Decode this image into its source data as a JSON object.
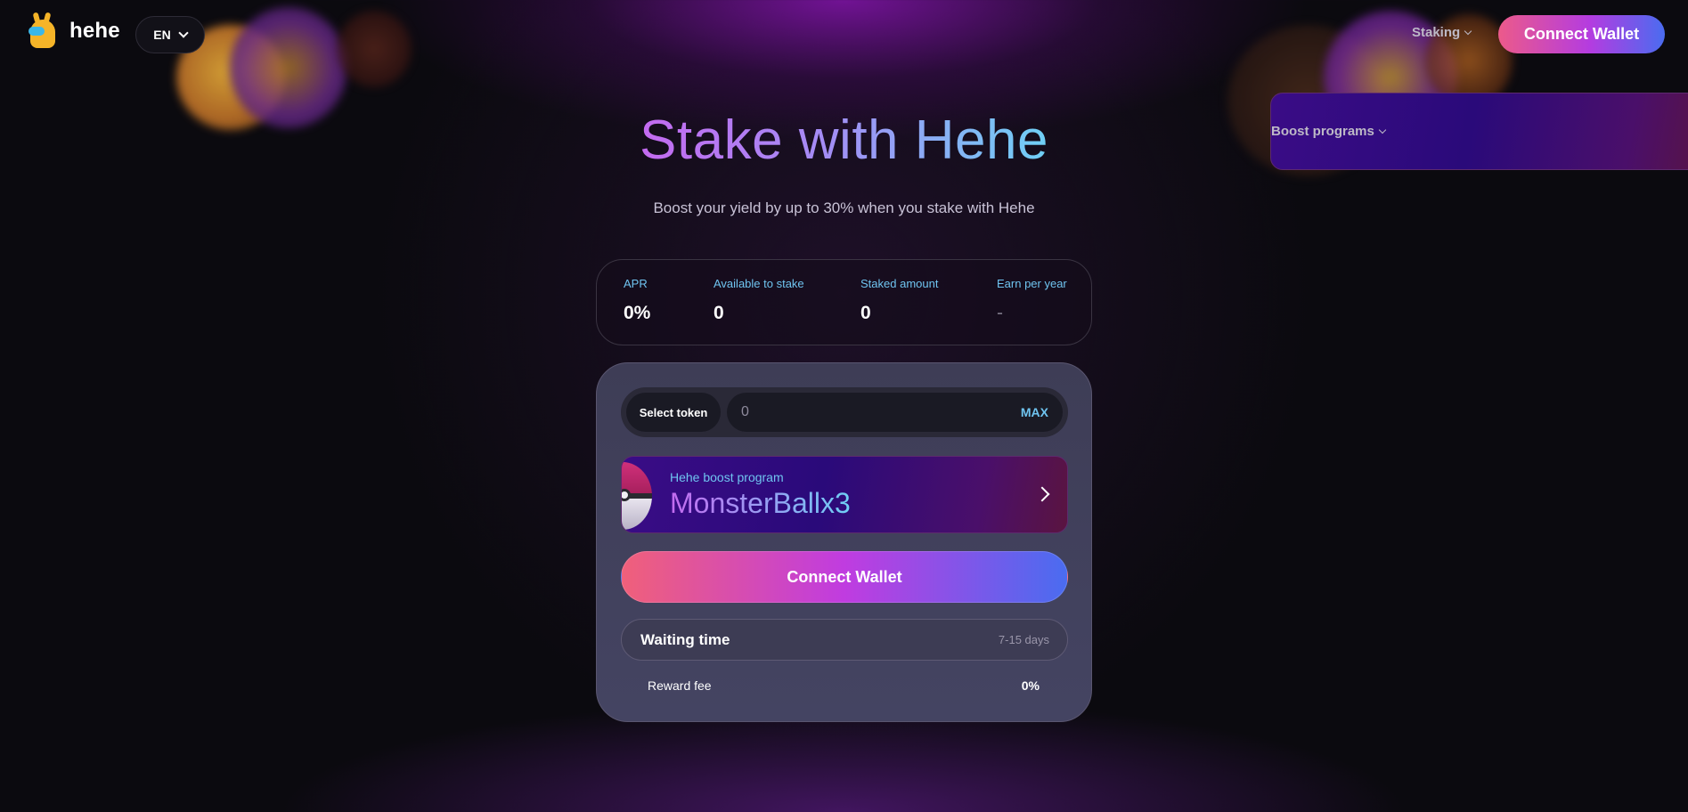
{
  "header": {
    "logo_text": "hehe",
    "language": "EN",
    "nav": [
      {
        "label": "Boost programs"
      },
      {
        "label": "Staking"
      }
    ],
    "connect_label": "Connect Wallet"
  },
  "hero": {
    "title": "Stake with Hehe",
    "subtitle": "Boost your yield by up to 30% when you stake with Hehe"
  },
  "stats": [
    {
      "label": "APR",
      "value": "0%"
    },
    {
      "label": "Available to stake",
      "value": "0"
    },
    {
      "label": "Staked amount",
      "value": "0"
    },
    {
      "label": "Earn per year",
      "value": "-"
    }
  ],
  "stake_form": {
    "select_token_label": "Select token",
    "amount_placeholder": "0",
    "max_label": "MAX",
    "boost_program": {
      "label": "Hehe boost program",
      "name": "MonsterBallx3"
    },
    "connect_label": "Connect Wallet",
    "waiting_time": {
      "label": "Waiting time",
      "value": "7-15 days"
    },
    "reward_fee": {
      "label": "Reward fee",
      "value": "0%"
    }
  },
  "colors": {
    "accent_cyan": "#6fc4f0",
    "gradient_pink": "#ec5a8a",
    "gradient_purple": "#b43ce0",
    "gradient_blue": "#4a6cf0",
    "background": "#0b0a0f",
    "card": "#3e3d56"
  },
  "icons": {
    "logo": "hehe-mascot-icon",
    "language_chevron": "chevron-down-icon",
    "boost_arrow": "chevron-right-icon",
    "boost_image": "monster-ball-icon"
  }
}
